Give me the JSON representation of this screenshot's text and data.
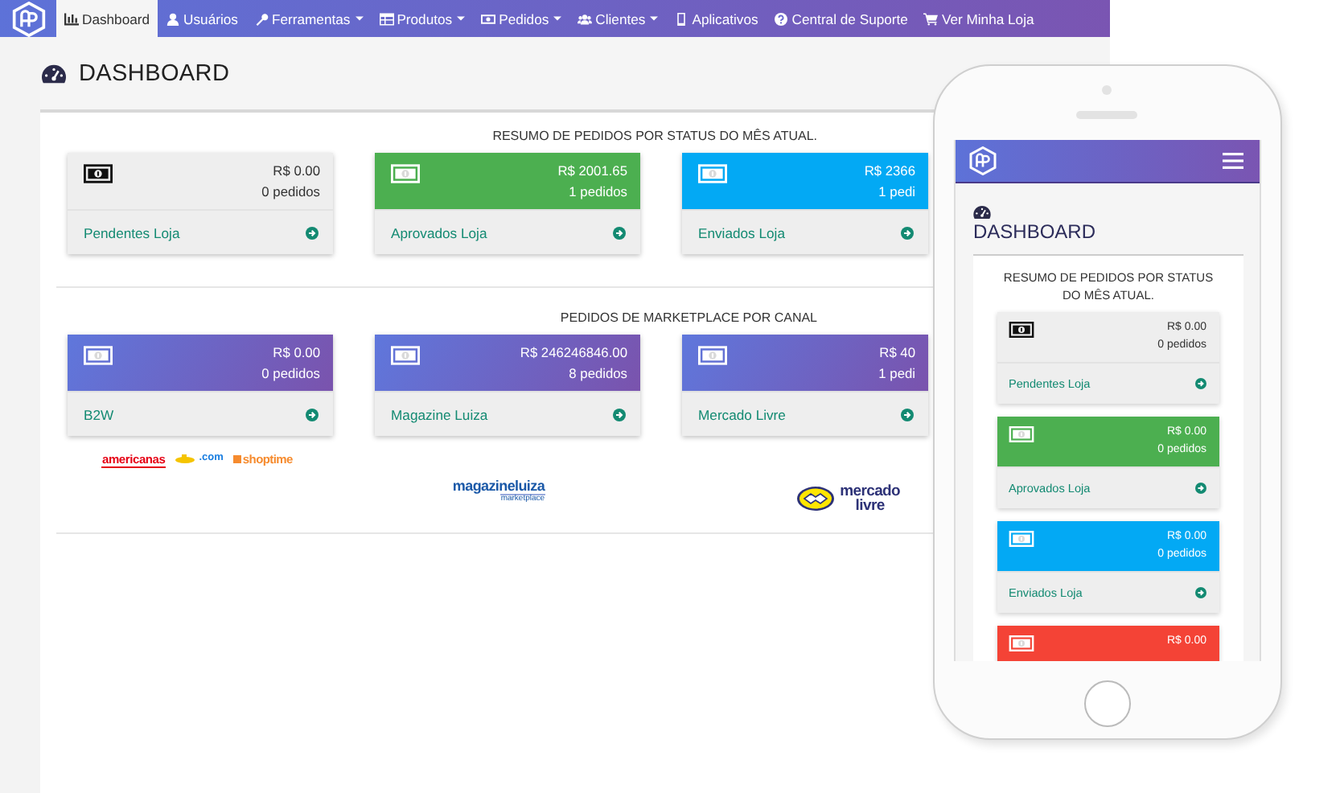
{
  "navbar": {
    "items": [
      {
        "label": "Dashboard",
        "dropdown": false,
        "selected": true
      },
      {
        "label": "Usuários",
        "dropdown": false,
        "selected": false
      },
      {
        "label": "Ferramentas",
        "dropdown": true,
        "selected": false
      },
      {
        "label": "Produtos",
        "dropdown": true,
        "selected": false
      },
      {
        "label": "Pedidos",
        "dropdown": true,
        "selected": false
      },
      {
        "label": "Clientes",
        "dropdown": true,
        "selected": false
      },
      {
        "label": "Aplicativos",
        "dropdown": false,
        "selected": false
      },
      {
        "label": "Central de Suporte",
        "dropdown": false,
        "selected": false
      },
      {
        "label": "Ver Minha Loja",
        "dropdown": false,
        "selected": false
      }
    ]
  },
  "page_title": "DASHBOARD",
  "status_section": {
    "title": "RESUMO DE PEDIDOS POR STATUS DO MÊS ATUAL.",
    "cards": [
      {
        "amount": "R$ 0.00",
        "orders": "0 pedidos",
        "label": "Pendentes Loja",
        "color": "#eeeeee"
      },
      {
        "amount": "R$ 2001.65",
        "orders": "1 pedidos",
        "label": "Aprovados Loja",
        "color": "#4caf50"
      },
      {
        "amount": "R$ 2366",
        "orders": "1 pedi",
        "label": "Enviados Loja",
        "color": "#03a9f4"
      }
    ]
  },
  "marketplace_section": {
    "title": "PEDIDOS DE MARKETPLACE POR CANAL",
    "cards": [
      {
        "amount": "R$ 0.00",
        "orders": "0 pedidos",
        "label": "B2W",
        "logos": [
          {
            "kind": "banner",
            "text": "americanas"
          },
          {
            "kind": "submarine",
            "text": ".com"
          },
          {
            "kind": "tag",
            "text": "shoptime"
          }
        ]
      },
      {
        "amount": "R$ 246246846.00",
        "orders": "8 pedidos",
        "label": "Magazine Luiza",
        "logos": [
          {
            "kind": "stacked",
            "text": "magazineluiza",
            "subtext": "marketplace"
          }
        ]
      },
      {
        "amount": "R$ 40",
        "orders": "1 pedi",
        "label": "Mercado Livre",
        "logos": [
          {
            "kind": "handshake",
            "text": "mercado",
            "subtext": "livre"
          }
        ]
      }
    ]
  },
  "mobile_preview": {
    "page_title": "DASHBOARD",
    "title": "RESUMO DE PEDIDOS POR STATUS DO MÊS ATUAL.",
    "cards": [
      {
        "amount": "R$ 0.00",
        "orders": "0 pedidos",
        "label": "Pendentes Loja",
        "color": "#eeeeee"
      },
      {
        "amount": "R$ 0.00",
        "orders": "0 pedidos",
        "label": "Aprovados Loja",
        "color": "#4caf50"
      },
      {
        "amount": "R$ 0.00",
        "orders": "0 pedidos",
        "label": "Enviados Loja",
        "color": "#03a9f4"
      },
      {
        "amount": "R$ 0.00",
        "color": "#f44336"
      }
    ]
  }
}
